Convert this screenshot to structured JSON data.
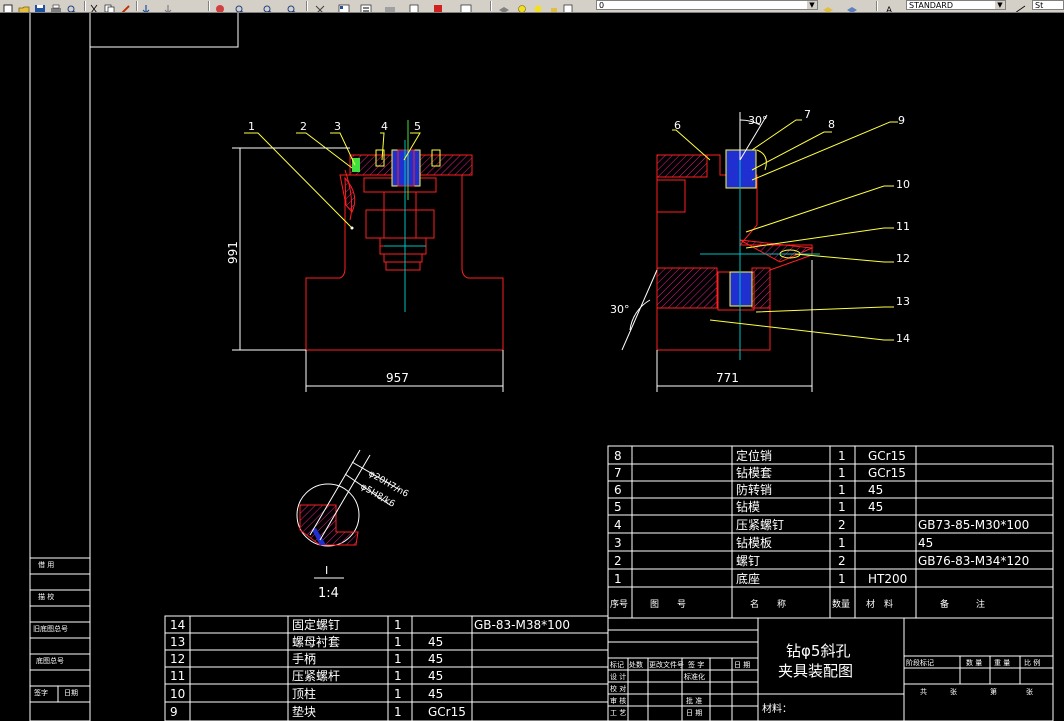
{
  "toolbar": {
    "layer_value": "0",
    "textstyle_value": "STANDARD",
    "right_combo_value": "St"
  },
  "view": {
    "dim_height": "991",
    "dim_width_left": "957",
    "dim_width_right": "771",
    "angle_top": "30°",
    "angle_left": "30°",
    "detail_fit1": "φ20H7/n6",
    "detail_fit2": "φ5H8/k6",
    "detail_label": "I",
    "detail_scale": "1:4",
    "balloons_left": [
      "1",
      "2",
      "3",
      "4",
      "5"
    ],
    "balloons_right": [
      "6",
      "7",
      "8",
      "9",
      "10",
      "11",
      "12",
      "13",
      "14"
    ]
  },
  "parts_upper": [
    {
      "no": "8",
      "name": "定位销",
      "qty": "1",
      "mat": "GCr15",
      "note": ""
    },
    {
      "no": "7",
      "name": "钻模套",
      "qty": "1",
      "mat": "GCr15",
      "note": ""
    },
    {
      "no": "6",
      "name": "防转销",
      "qty": "1",
      "mat": "45",
      "note": ""
    },
    {
      "no": "5",
      "name": "钻模",
      "qty": "1",
      "mat": "45",
      "note": ""
    },
    {
      "no": "4",
      "name": "压紧螺钉",
      "qty": "2",
      "mat": "",
      "note": "GB73-85-M30*100"
    },
    {
      "no": "3",
      "name": "钻模板",
      "qty": "1",
      "mat": "",
      "note": "45"
    },
    {
      "no": "2",
      "name": "螺钉",
      "qty": "2",
      "mat": "",
      "note": "GB76-83-M34*120"
    },
    {
      "no": "1",
      "name": "底座",
      "qty": "1",
      "mat": "HT200",
      "note": ""
    }
  ],
  "parts_header": {
    "no": "序号",
    "code": "图　　号",
    "name": "名　　称",
    "qty": "数量",
    "mat": "材　料",
    "note": "备　　　注"
  },
  "parts_lower": [
    {
      "no": "14",
      "name": "固定螺钉",
      "qty": "1",
      "mat": "",
      "note": "GB-83-M38*100"
    },
    {
      "no": "13",
      "name": "螺母衬套",
      "qty": "1",
      "mat": "45",
      "note": ""
    },
    {
      "no": "12",
      "name": "手柄",
      "qty": "1",
      "mat": "45",
      "note": ""
    },
    {
      "no": "11",
      "name": "压紧螺杆",
      "qty": "1",
      "mat": "45",
      "note": ""
    },
    {
      "no": "10",
      "name": "顶柱",
      "qty": "1",
      "mat": "45",
      "note": ""
    },
    {
      "no": "9",
      "name": "垫块",
      "qty": "1",
      "mat": "GCr15",
      "note": ""
    }
  ],
  "title_block": {
    "title_line1": "钻φ5斜孔",
    "title_line2": "夹具装配图",
    "material_label": "材料：",
    "standardization": "标准化",
    "ratio": "比 例",
    "weight": "重 量",
    "quantity": "数 量",
    "stage_mark": "阶段标记",
    "sheet_total": "共",
    "sheet": "张",
    "sheet_no": "第",
    "approve": "批 准",
    "date": "日 期",
    "rows": [
      "标记",
      "设 计",
      "校 对",
      "审 核",
      "工 艺"
    ],
    "cols": [
      "处数",
      "更改文件号",
      "签 字",
      "日 期"
    ]
  },
  "side_block": [
    "借 用",
    "描 校",
    "旧底图总号",
    "底图总号",
    "签字",
    "日期"
  ]
}
